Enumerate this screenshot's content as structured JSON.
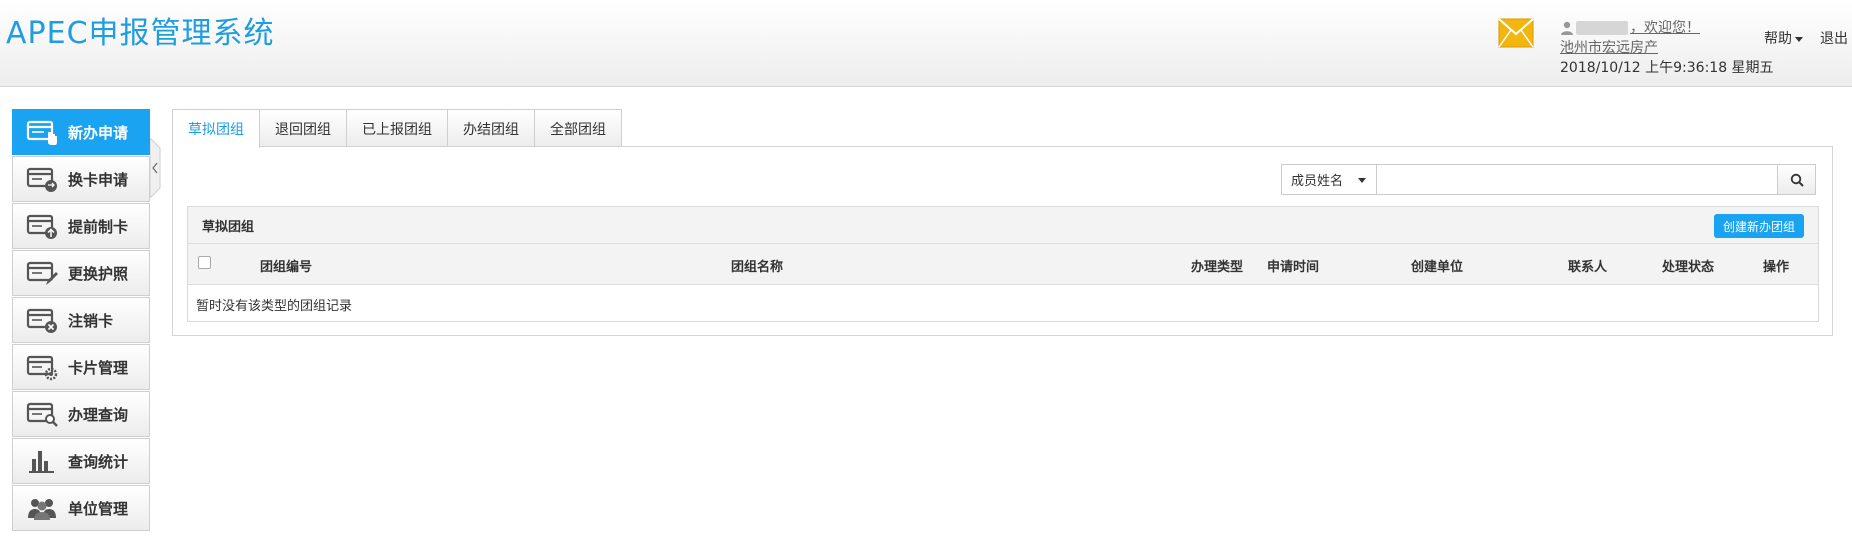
{
  "header": {
    "app_title": "APEC申报管理系统",
    "welcome": "，欢迎您！",
    "organization": "池州市宏远房产",
    "datetime": "2018/10/12 上午9:36:18  星期五",
    "help": "帮助",
    "logout": "退出"
  },
  "sidebar": {
    "items": [
      {
        "label": "新办申请",
        "icon": "card-hand-icon"
      },
      {
        "label": "换卡申请",
        "icon": "card-exchange-icon"
      },
      {
        "label": "提前制卡",
        "icon": "card-upload-icon"
      },
      {
        "label": "更换护照",
        "icon": "card-edit-icon"
      },
      {
        "label": "注销卡",
        "icon": "card-cancel-icon"
      },
      {
        "label": "卡片管理",
        "icon": "card-gear-icon"
      },
      {
        "label": "办理查询",
        "icon": "card-search-icon"
      },
      {
        "label": "查询统计",
        "icon": "bar-chart-icon"
      },
      {
        "label": "单位管理",
        "icon": "users-icon"
      }
    ],
    "active_index": 0
  },
  "tabs": [
    {
      "label": "草拟团组"
    },
    {
      "label": "退回团组"
    },
    {
      "label": "已上报团组"
    },
    {
      "label": "办结团组"
    },
    {
      "label": "全部团组"
    }
  ],
  "search": {
    "field_selected": "成员姓名",
    "value": ""
  },
  "group_panel": {
    "title": "草拟团组",
    "create_button": "创建新办团组",
    "columns": [
      "团组编号",
      "团组名称",
      "办理类型",
      "申请时间",
      "创建单位",
      "联系人",
      "处理状态",
      "操作"
    ],
    "empty_message": "暂时没有该类型的团组记录"
  },
  "colors": {
    "accent": "#1aa3f0",
    "title": "#1e9de0",
    "mail": "#f2b60f"
  }
}
